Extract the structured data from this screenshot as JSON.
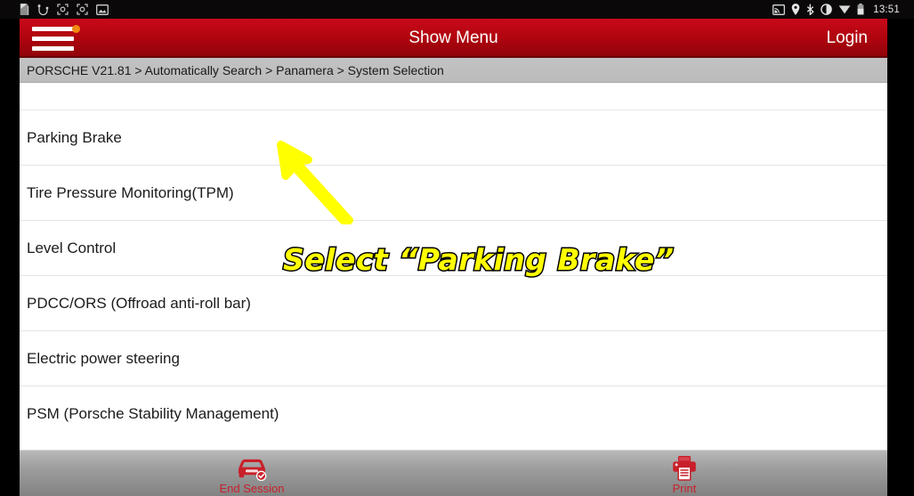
{
  "status_bar": {
    "time": "13:51",
    "left_icons": [
      "sd-card-icon",
      "usb-debug-icon",
      "screenshot-icon",
      "screenshot-icon",
      "image-icon"
    ],
    "right_icons": [
      "cast-icon",
      "location-pin-icon",
      "bluetooth-icon",
      "do-not-disturb-icon",
      "wifi-icon",
      "battery-icon"
    ]
  },
  "app_bar": {
    "menu_icon": "hamburger-menu-icon",
    "menu_badge": "notification-dot",
    "title": "Show Menu",
    "login_label": "Login",
    "bar_color": "#b2050f",
    "badge_color": "#f08a12"
  },
  "breadcrumb": {
    "text": "PORSCHE V21.81 > Automatically Search > Panamera > System Selection"
  },
  "system_list": {
    "items": [
      {
        "label": "",
        "blank": true
      },
      {
        "label": "Parking Brake",
        "blank": false
      },
      {
        "label": "Tire Pressure Monitoring(TPM)",
        "blank": false
      },
      {
        "label": "Level Control",
        "blank": false
      },
      {
        "label": "PDCC/ORS (Offroad anti-roll bar)",
        "blank": false
      },
      {
        "label": "Electric power steering",
        "blank": false
      },
      {
        "label": "PSM (Porsche Stability Management)",
        "blank": false
      }
    ]
  },
  "toolbar": {
    "buttons": [
      {
        "label": "End Session",
        "icon": "car-check-icon"
      },
      {
        "label": "Print",
        "icon": "printer-icon"
      }
    ],
    "accent_color": "#c8202a"
  },
  "annotation": {
    "text_prefix": "Select ",
    "text_quoted": "“Parking Brake”",
    "full_text": "Select “Parking Brake”",
    "text_color": "#ffff00",
    "outline_color": "#000000",
    "arrow_color": "#ffff00",
    "arrow_name": "pointer-arrow"
  }
}
